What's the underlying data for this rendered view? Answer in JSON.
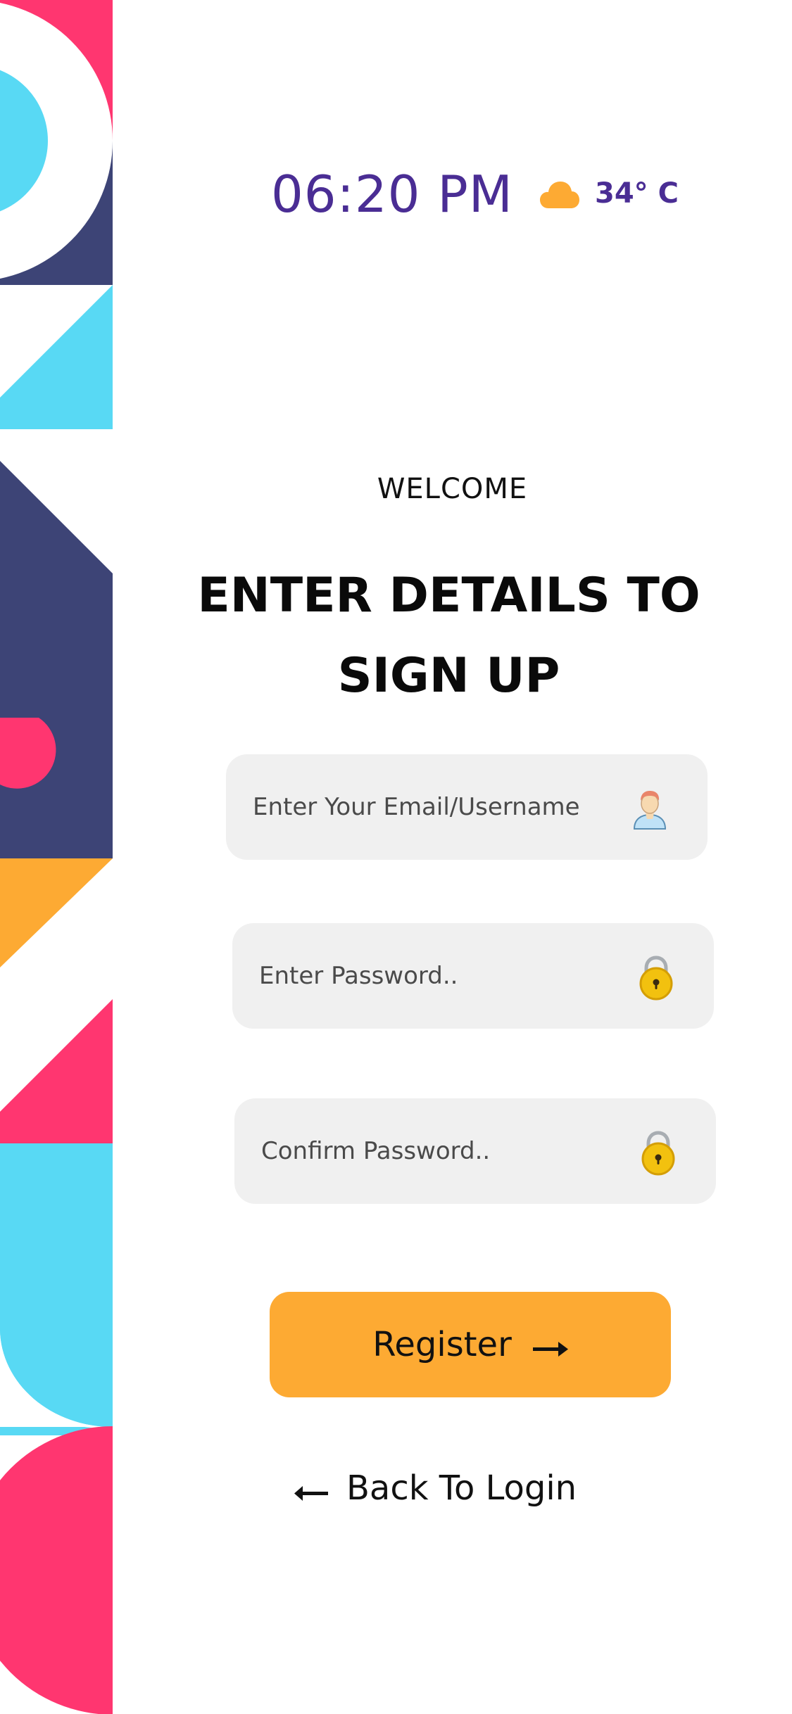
{
  "status": {
    "time": "06:20 PM",
    "temperature": "34° C",
    "weather_icon": "cloud-icon"
  },
  "heading": {
    "welcome": "WELCOME",
    "title_line1": "ENTER DETAILS TO",
    "title_line2": "SIGN UP"
  },
  "form": {
    "email": {
      "value": "",
      "placeholder": "Enter Your Email/Username",
      "icon": "user-avatar-icon"
    },
    "password": {
      "value": "",
      "placeholder": "Enter Password..",
      "icon": "padlock-icon"
    },
    "confirm_password": {
      "value": "",
      "placeholder": "Confirm Password..",
      "icon": "padlock-icon"
    }
  },
  "actions": {
    "register_label": "Register",
    "register_icon": "arrow-right-icon",
    "back_label": "Back To Login",
    "back_icon": "arrow-left-icon"
  },
  "colors": {
    "accent_orange": "#fdaa33",
    "text_purple": "#4a2d94",
    "deco_pink": "#ff3670",
    "deco_navy": "#3d4476",
    "deco_cyan": "#58d9f4",
    "input_bg": "#f0f0f0"
  }
}
